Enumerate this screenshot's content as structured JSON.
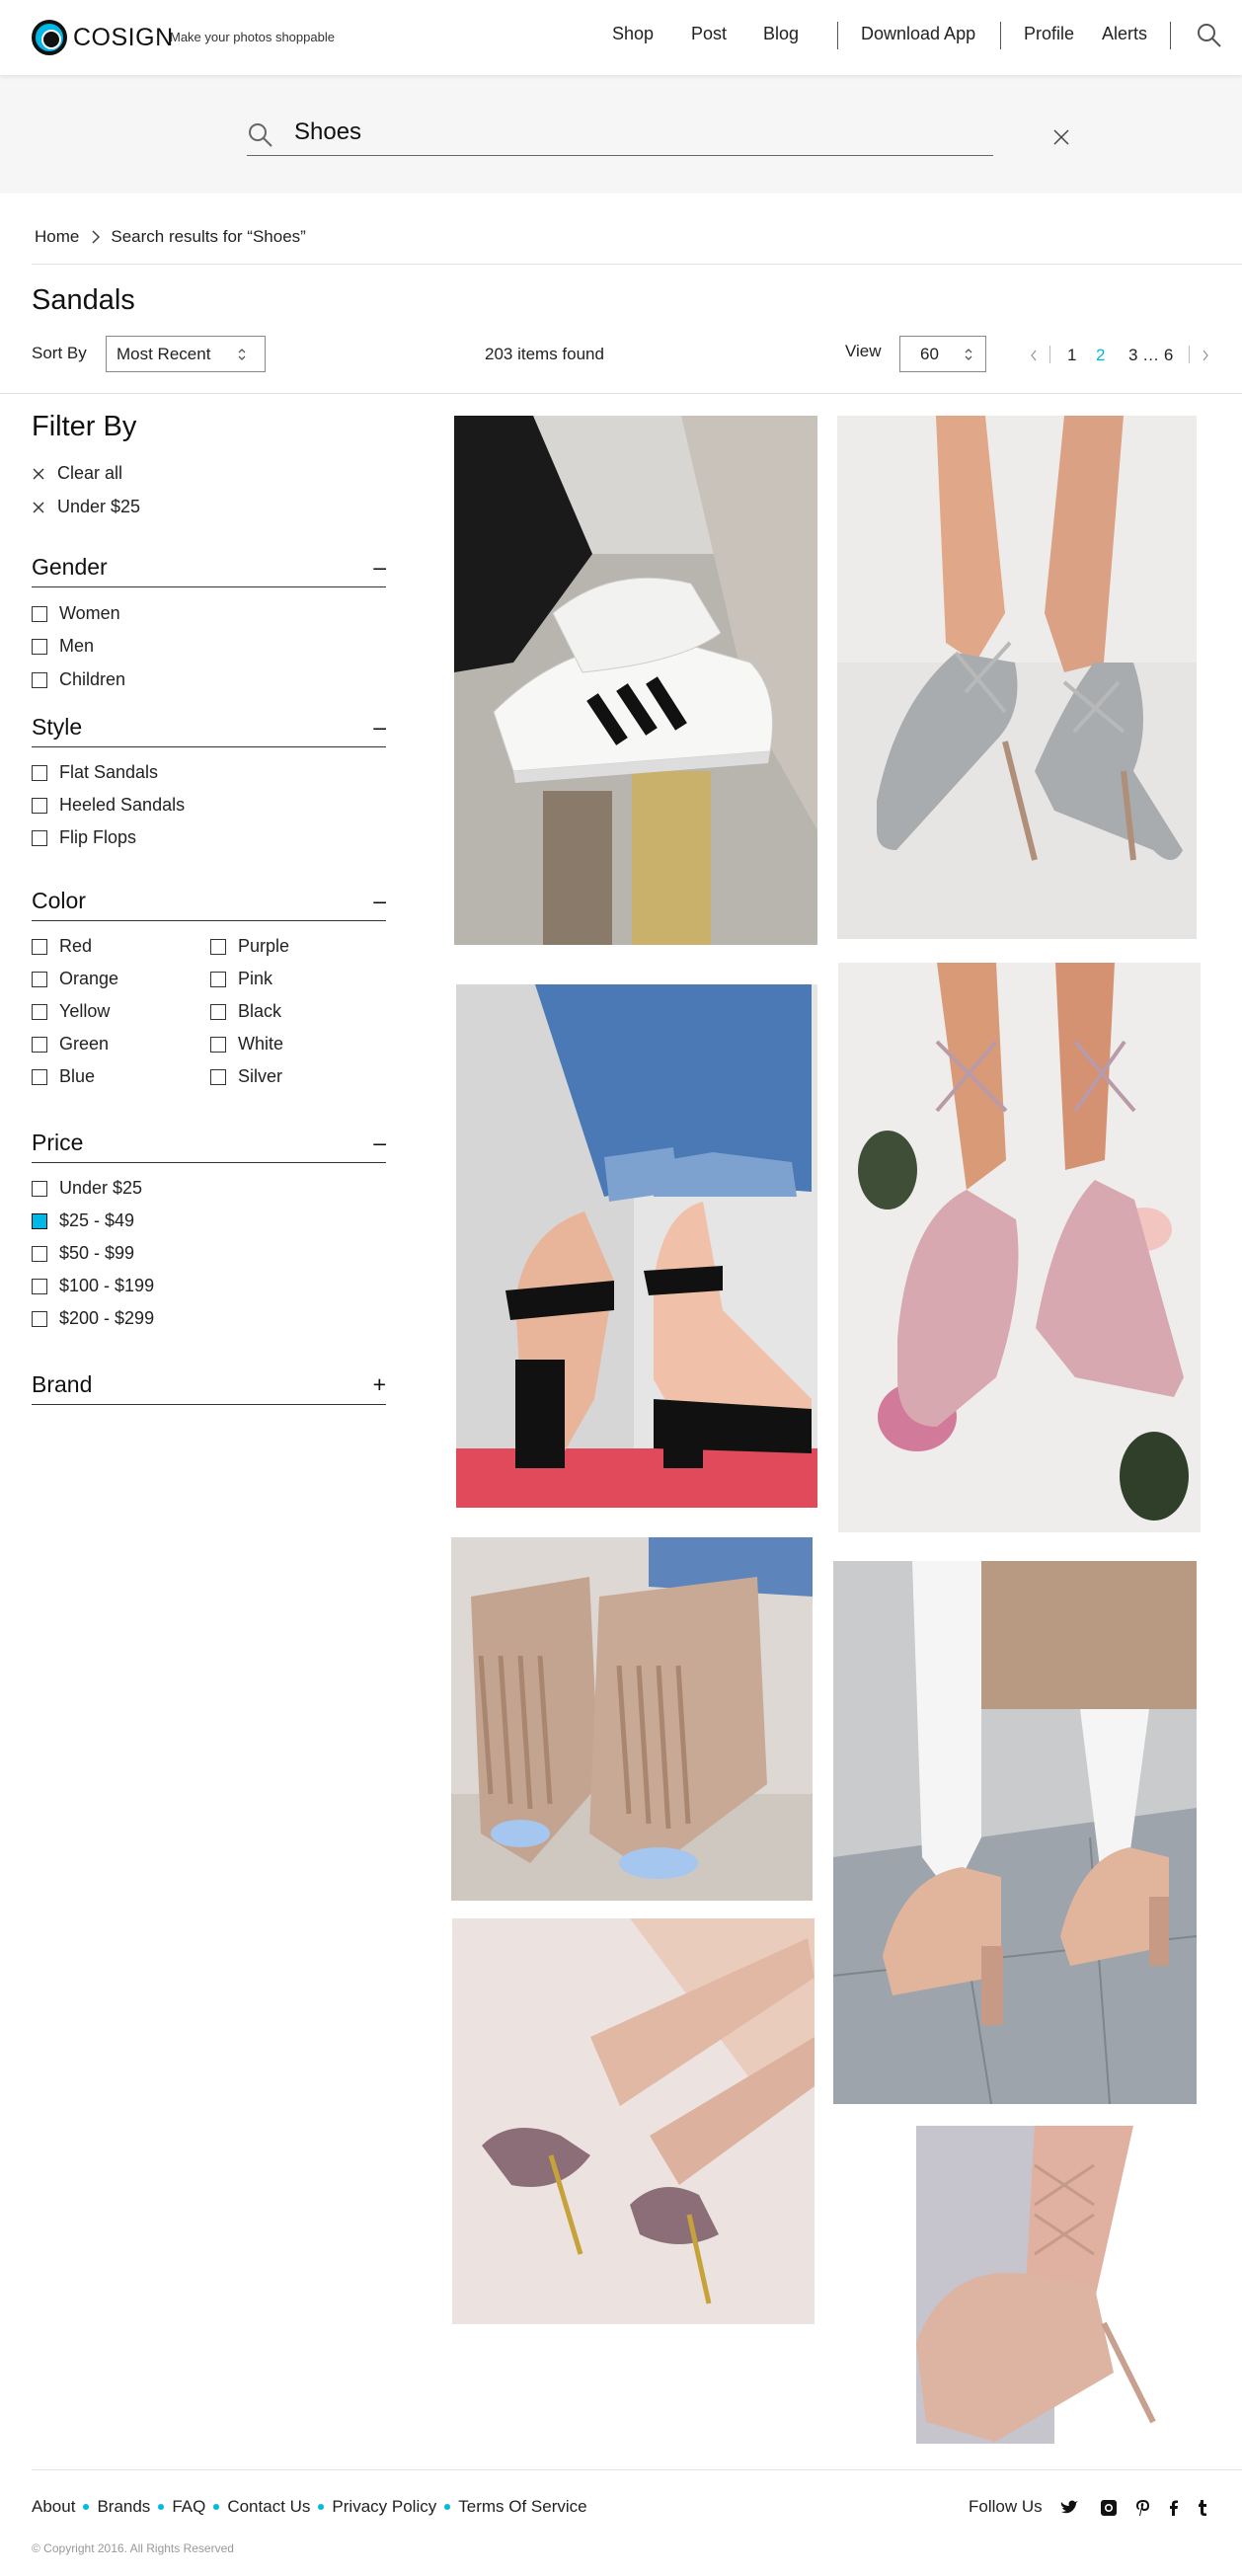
{
  "brand": {
    "name": "COSIGN",
    "tagline": "Make your photos shoppable",
    "accent": "#00b8e6"
  },
  "nav": {
    "shop": "Shop",
    "post": "Post",
    "blog": "Blog",
    "download": "Download App",
    "profile": "Profile",
    "alerts": "Alerts"
  },
  "search": {
    "value": "Shoes"
  },
  "breadcrumb": {
    "home": "Home",
    "current": "Search results for “Shoes”"
  },
  "results": {
    "title": "Sandals",
    "sort_label": "Sort By",
    "sort_value": "Most Recent",
    "count_text": "203 items found",
    "view_label": "View",
    "view_value": "60",
    "pages": [
      "1",
      "2",
      "3 … 6"
    ],
    "current_page": "2"
  },
  "filters": {
    "title": "Filter By",
    "clear_all": "Clear all",
    "applied": [
      "Under $25"
    ],
    "gender": {
      "label": "Gender",
      "toggle": "–",
      "options": [
        "Women",
        "Men",
        "Children"
      ]
    },
    "style": {
      "label": "Style",
      "toggle": "–",
      "options": [
        "Flat Sandals",
        "Heeled Sandals",
        "Flip Flops"
      ]
    },
    "color": {
      "label": "Color",
      "toggle": "–",
      "options": [
        "Red",
        "Purple",
        "Orange",
        "Pink",
        "Yellow",
        "Black",
        "Green",
        "White",
        "Blue",
        "Silver"
      ]
    },
    "price": {
      "label": "Price",
      "toggle": "–",
      "options": [
        "Under $25",
        "$25 - $49",
        "$50 - $99",
        "$100 - $199",
        "$200 - $299"
      ],
      "checked": "$25 - $49"
    },
    "brand": {
      "label": "Brand",
      "toggle": "+"
    }
  },
  "footer": {
    "links": [
      "About",
      "Brands",
      "FAQ",
      "Contact Us",
      "Privacy Policy",
      "Terms Of Service"
    ],
    "follow": "Follow Us",
    "social": [
      "twitter-icon",
      "instagram-icon",
      "pinterest-icon",
      "facebook-icon",
      "tumblr-icon"
    ],
    "copyright": "© Copyright 2016. All Rights Reserved"
  }
}
